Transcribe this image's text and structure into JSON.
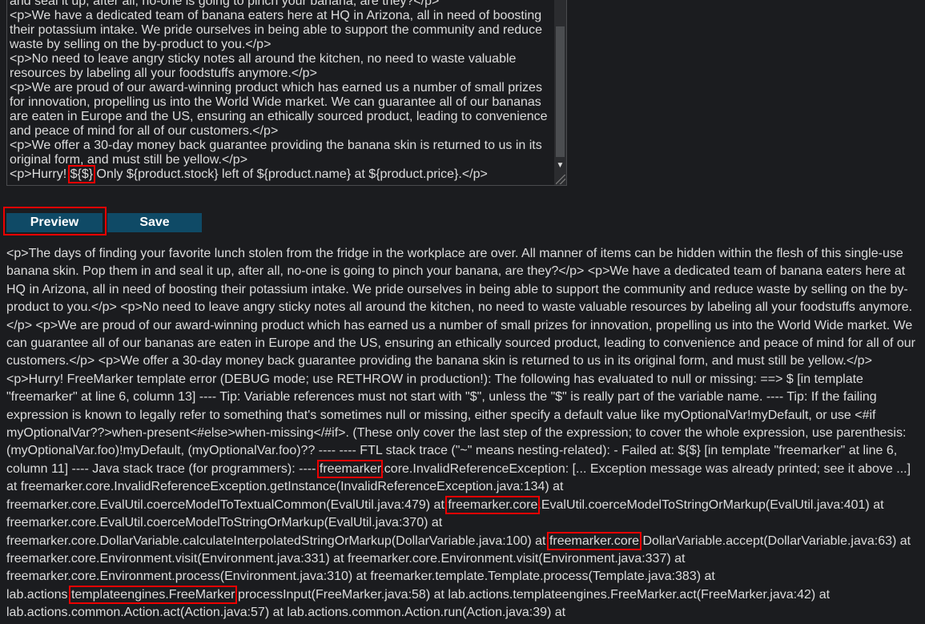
{
  "editor": {
    "value_lines": [
      "and seal it up, after all, no-one is going to pinch your banana, are they?</p>",
      "<p>We have a dedicated team of banana eaters here at HQ in Arizona, all in need of boosting their potassium intake. We pride ourselves in being able to support the community and reduce waste by selling on the by-product to you.</p>",
      "<p>No need to leave angry sticky notes all around the kitchen, no need to waste valuable resources by labeling all your foodstuffs anymore.</p>",
      "<p>We are proud of our award-winning product which has earned us a number of small prizes for innovation, propelling us into the World Wide market. We can guarantee all of our bananas are eaten in Europe and the US, ensuring an ethically sourced product, leading to convenience and peace of mind for all of our customers.</p>",
      "<p>We offer a 30-day money back guarantee providing the banana skin is returned to us in its original form, and must still be yellow.</p>"
    ],
    "last_line_before": "<p>Hurry! ",
    "last_line_highlight": "${$}",
    "last_line_after": " Only ${product.stock} left of ${product.name} at ${product.price}.</p>"
  },
  "buttons": {
    "preview": "Preview",
    "save": "Save"
  },
  "output": {
    "seg0": "<p>The days of finding your favorite lunch stolen from the fridge in the workplace are over. All manner of items can be hidden within the flesh of this single-use banana skin. Pop them in and seal it up, after all, no-one is going to pinch your banana, are they?</p> <p>We have a dedicated team of banana eaters here at HQ in Arizona, all in need of boosting their potassium intake. We pride ourselves in being able to support the community and reduce waste by selling on the by-product to you.</p> <p>No need to leave angry sticky notes all around the kitchen, no need to waste valuable resources by labeling all your foodstuffs anymore.</p> <p>We are proud of our award-winning product which has earned us a number of small prizes for innovation, propelling us into the World Wide market. We can guarantee all of our bananas are eaten in Europe and the US, ensuring an ethically sourced product, leading to convenience and peace of mind for all of our customers.</p> <p>We offer a 30-day money back guarantee providing the banana skin is returned to us in its original form, and must still be yellow.</p> <p>Hurry! FreeMarker template error (DEBUG mode; use RETHROW in production!): The following has evaluated to null or missing: ==> $ [in template \"freemarker\" at line 6, column 13] ---- Tip: Variable references must not start with \"$\", unless the \"$\" is really part of the variable name. ---- Tip: If the failing expression is known to legally refer to something that's sometimes null or missing, either specify a default value like myOptionalVar!myDefault, or use <#if myOptionalVar??>when-present<#else>when-missing</#if>. (These only cover the last step of the expression; to cover the whole expression, use parenthesis: (myOptionalVar.foo)!myDefault, (myOptionalVar.foo)?? ---- ---- FTL stack trace (\"~\" means nesting-related): - Failed at: ${$} [in template \"freemarker\" at line 6, column 11] ---- Java stack trace (for programmers): ---- ",
    "hl1": "freemarker",
    "seg1": ".core.InvalidReferenceException: [... Exception message was already printed; see it above ...] at freemarker.core.InvalidReferenceException.getInstance(InvalidReferenceException.java:134) at freemarker.core.EvalUtil.coerceModelToTextualCommon(EvalUtil.java:479) at ",
    "hl2": "freemarker.core",
    "seg2": ".EvalUtil.coerceModelToStringOrMarkup(EvalUtil.java:401) at freemarker.core.EvalUtil.coerceModelToStringOrMarkup(EvalUtil.java:370) at freemarker.core.DollarVariable.calculateInterpolatedStringOrMarkup(DollarVariable.java:100) at ",
    "hl3": "freemarker.core",
    "seg3": ".DollarVariable.accept(DollarVariable.java:63) at freemarker.core.Environment.visit(Environment.java:331) at freemarker.core.Environment.visit(Environment.java:337) at freemarker.core.Environment.process(Environment.java:310) at freemarker.template.Template.process(Template.java:383) at lab.actions.",
    "hl4": "templateengines.FreeMarker",
    "seg4": ".processInput(FreeMarker.java:58) at lab.actions.templateengines.FreeMarker.act(FreeMarker.java:42) at lab.actions.common.Action.act(Action.java:57) at lab.actions.common.Action.run(Action.java:39) at"
  }
}
